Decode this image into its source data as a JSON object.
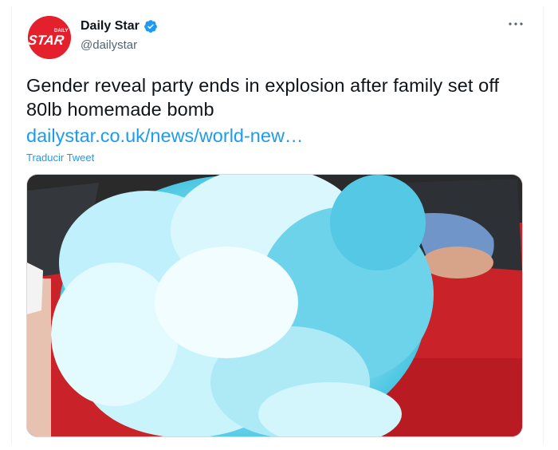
{
  "author": {
    "display_name": "Daily Star",
    "handle": "@dailystar",
    "avatar_logo": "STAR",
    "avatar_small_text": "DAILY",
    "verified": true,
    "avatar_color": "#e3202b"
  },
  "tweet": {
    "text": "Gender reveal party ends in explosion after family set off 80lb homemade bomb",
    "link": "dailystar.co.uk/news/world-new…",
    "translate_label": "Traducir Tweet"
  },
  "media": {
    "description_icon": "photo",
    "smoke_color": "#5fd0e8",
    "car_color": "#d8262c"
  },
  "icons": {
    "more": "more-horizontal-icon",
    "verified": "verified-badge-icon"
  },
  "colors": {
    "link": "#1d9bf0",
    "secondary_text": "#536471"
  }
}
